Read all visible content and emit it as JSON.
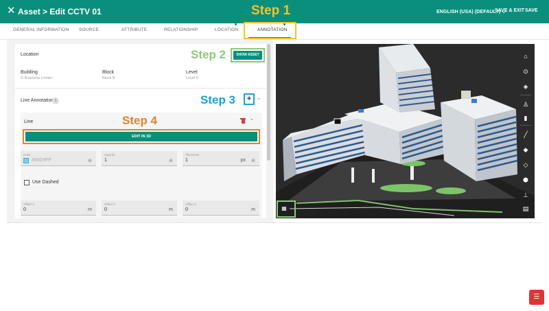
{
  "header": {
    "title": "Asset > Edit CCTV 01",
    "language": "ENGLISH (USA) (DEFAULT)",
    "save_exit": "SAVE & EXIT",
    "save": "SAVE"
  },
  "steps": {
    "step1": "Step 1",
    "step2": "Step 2",
    "step3": "Step 3",
    "step4": "Step 4"
  },
  "tabs": [
    {
      "label": "GENERAL INFORMATION"
    },
    {
      "label": "SOURCE"
    },
    {
      "label": "ATTRIBUTE"
    },
    {
      "label": "RELATIONSHIP"
    },
    {
      "label": "LOCATION"
    },
    {
      "label": "ANNOTATION"
    }
  ],
  "location": {
    "label": "Location",
    "show_asset": "SHOW ASSET",
    "fields": [
      {
        "label": "Building",
        "value": "G Business Center"
      },
      {
        "label": "Block",
        "value": "Block B"
      },
      {
        "label": "Level",
        "value": "Level 5"
      }
    ]
  },
  "line_annotation": {
    "label": "Line Annotation",
    "count": "1",
    "add": "+",
    "line": {
      "label": "Line",
      "edit_button": "EDIT IN 3D",
      "color_label": "Color",
      "color_value": "#66D9FF",
      "opacity_label": "Opacity",
      "opacity_value": "1",
      "thickness_label": "Thickness",
      "thickness_value": "1",
      "thickness_unit": "px",
      "use_dashed": "Use Dashed",
      "offset_x_label": "Offset X",
      "offset_x_value": "0",
      "offset_y_label": "Offset Y",
      "offset_y_value": "0",
      "offset_z_label": "Offset Z",
      "offset_z_value": "0",
      "offset_unit": "m"
    }
  },
  "colors": {
    "primary": "#0a8f7d",
    "step1": "#f2c428",
    "step2": "#8cc97a",
    "step3": "#1da0db",
    "step4": "#e5822f",
    "line_color": "#66D9FF",
    "delete": "#d83b3b"
  },
  "viewport_tools": [
    "home-icon",
    "focus-icon",
    "fill-icon",
    "person-icon",
    "camera-icon",
    "measure-icon",
    "layers-add-icon",
    "layers-icon",
    "box-icon",
    "hierarchy-icon",
    "report-icon"
  ]
}
